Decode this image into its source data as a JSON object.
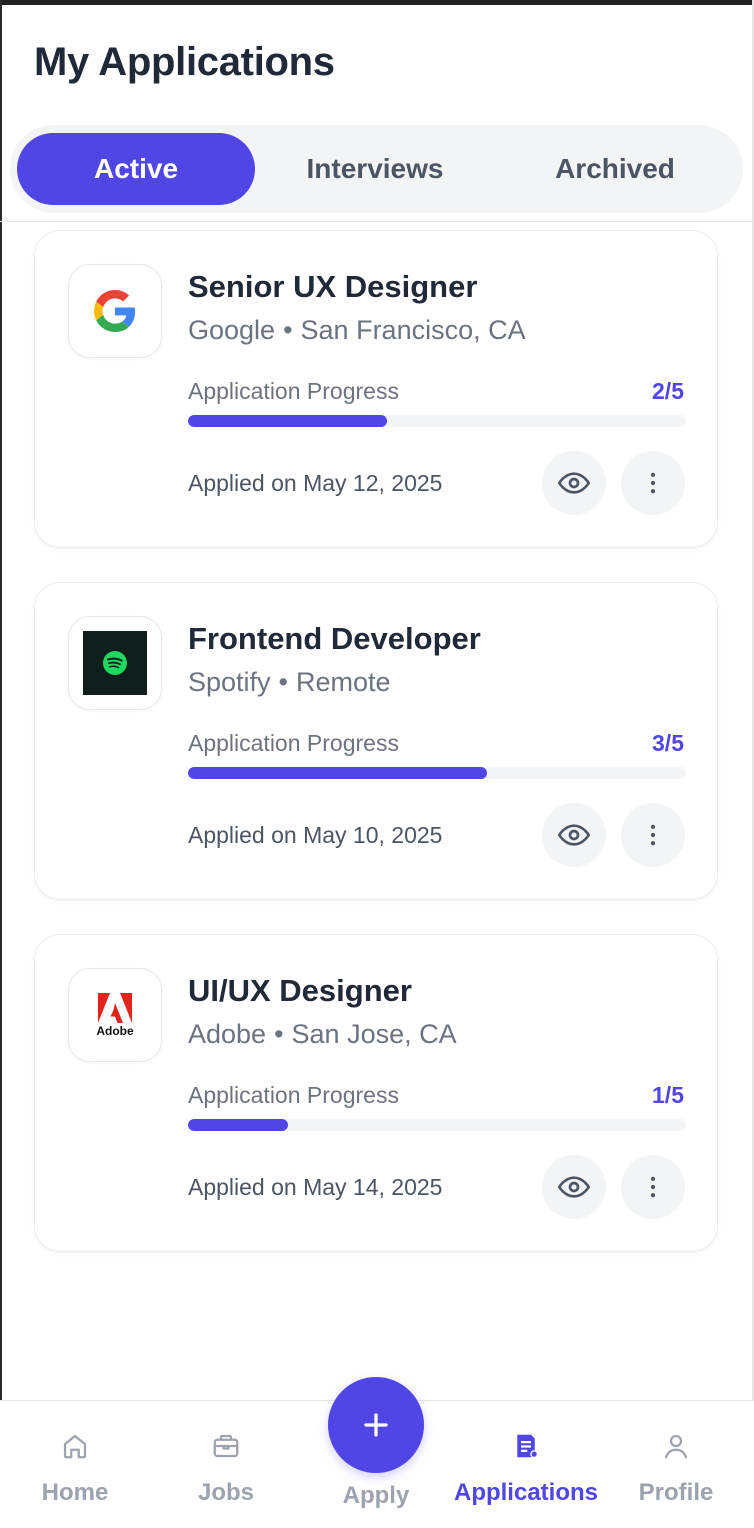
{
  "page": {
    "title": "My Applications"
  },
  "tabs": [
    {
      "label": "Active",
      "active": true
    },
    {
      "label": "Interviews",
      "active": false
    },
    {
      "label": "Archived",
      "active": false
    }
  ],
  "applications": [
    {
      "title": "Senior UX Designer",
      "company": "Google",
      "location": "San Francisco, CA",
      "logo_icon": "google-logo",
      "progress_label": "Application Progress",
      "progress_text": "2/5",
      "progress_fraction": 0.4,
      "applied": "Applied on May 12, 2025"
    },
    {
      "title": "Frontend Developer",
      "company": "Spotify",
      "location": "Remote",
      "logo_icon": "spotify-logo",
      "progress_label": "Application Progress",
      "progress_text": "3/5",
      "progress_fraction": 0.6,
      "applied": "Applied on May 10, 2025"
    },
    {
      "title": "UI/UX Designer",
      "company": "Adobe",
      "location": "San Jose, CA",
      "logo_icon": "adobe-logo",
      "logo_text": "Adobe",
      "progress_label": "Application Progress",
      "progress_text": "1/5",
      "progress_fraction": 0.2,
      "applied": "Applied on May 14, 2025"
    }
  ],
  "separator": "•",
  "bottom_nav": {
    "items": [
      {
        "label": "Home",
        "icon": "home-icon",
        "active": false
      },
      {
        "label": "Jobs",
        "icon": "briefcase-icon",
        "active": false
      },
      {
        "label": "Apply",
        "icon": "plus-icon",
        "active": false
      },
      {
        "label": "Applications",
        "icon": "document-icon",
        "active": true
      },
      {
        "label": "Profile",
        "icon": "user-icon",
        "active": false
      }
    ]
  },
  "colors": {
    "accent": "#4f46e5",
    "text_primary": "#1f2937",
    "text_secondary": "#6b7280",
    "muted": "#9ca3af",
    "track": "#f3f4f6"
  }
}
